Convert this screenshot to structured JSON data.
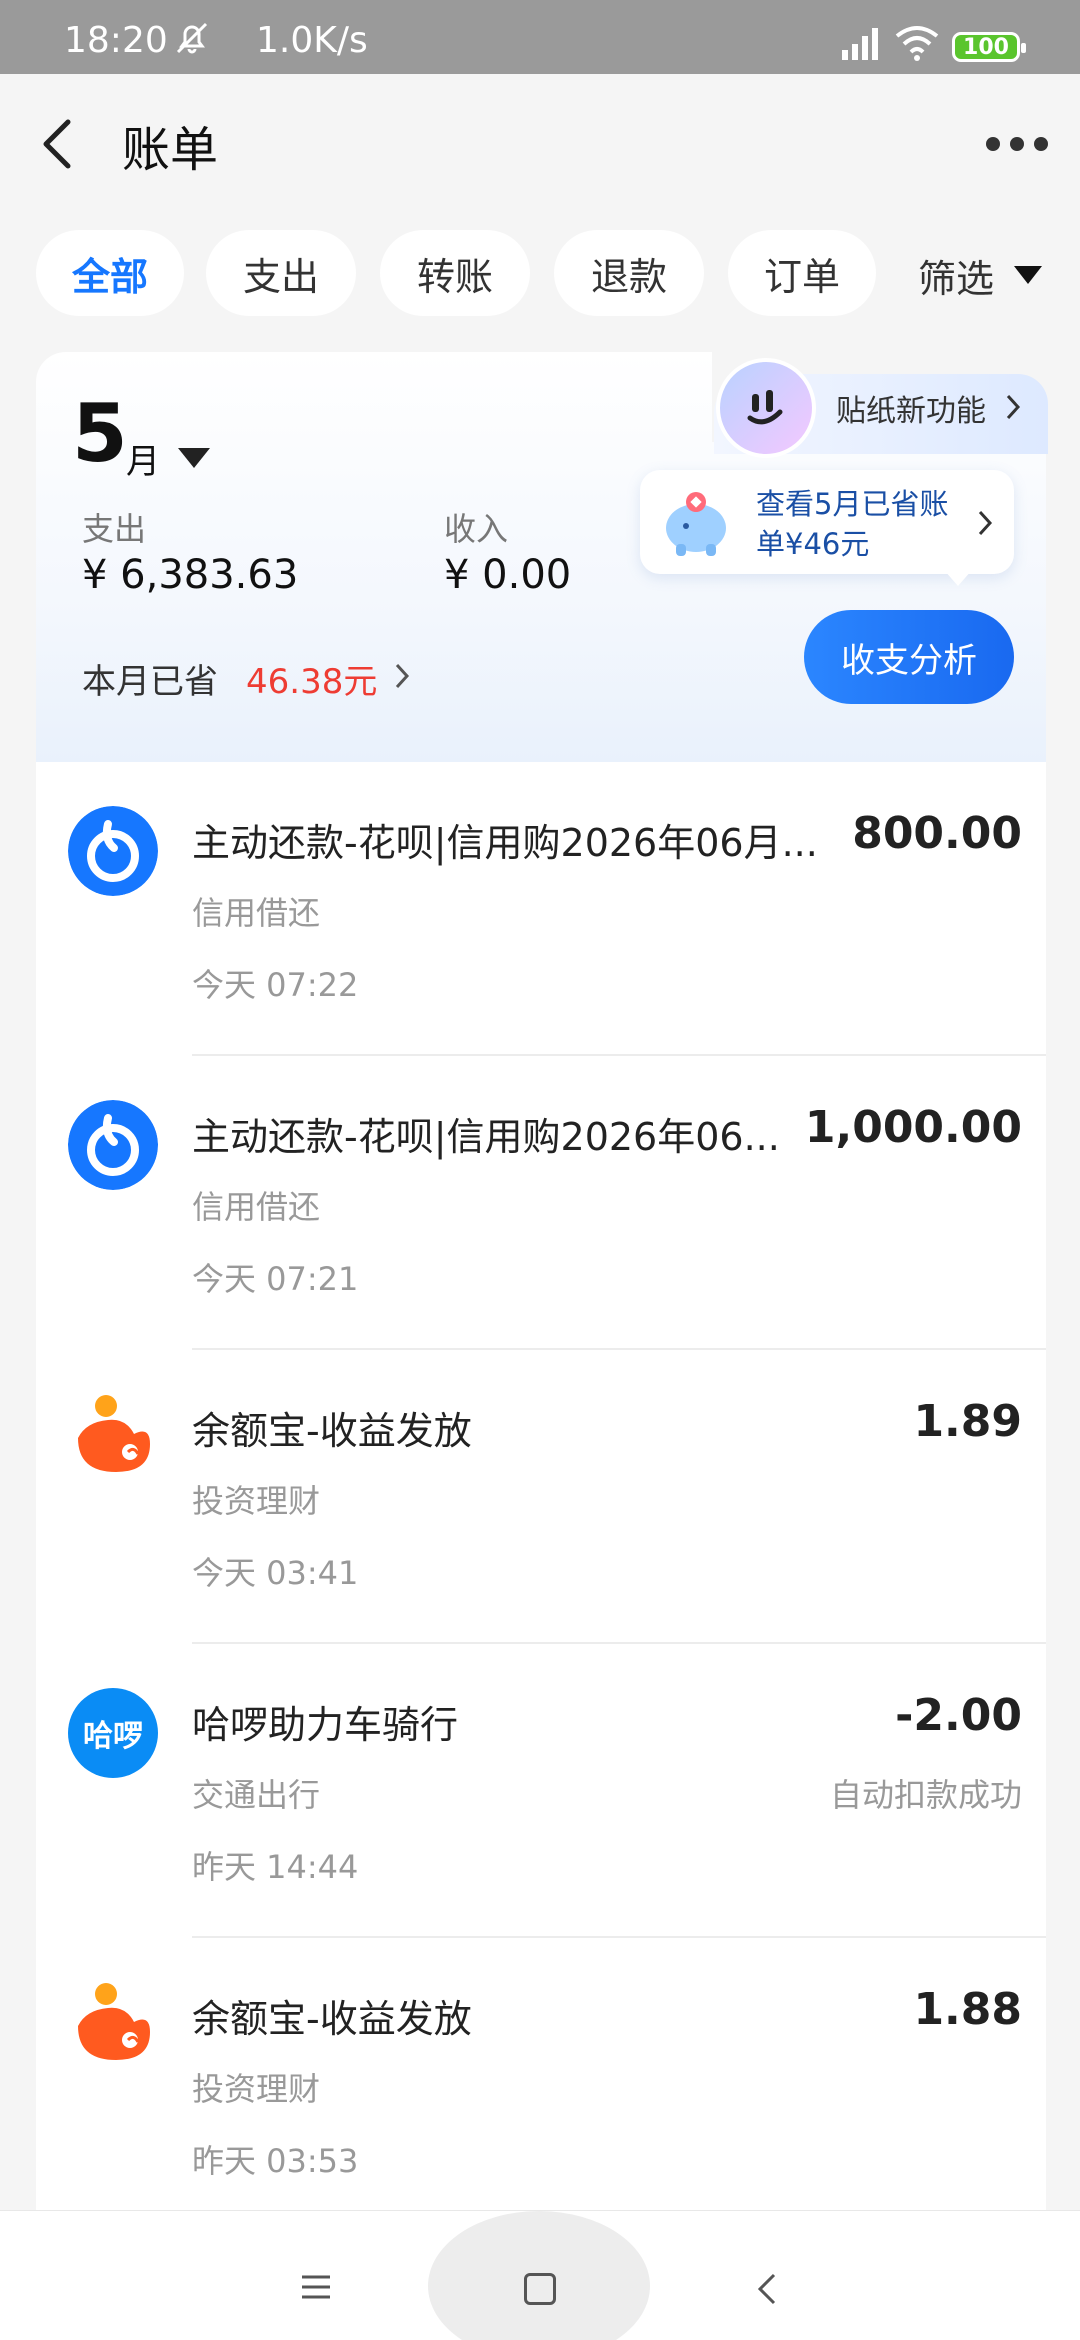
{
  "status_bar": {
    "time": "18:20",
    "net_speed": "1.0K/s",
    "battery": "100"
  },
  "header": {
    "title": "账单"
  },
  "tabs": [
    {
      "label": "全部",
      "active": true
    },
    {
      "label": "支出",
      "active": false
    },
    {
      "label": "转账",
      "active": false
    },
    {
      "label": "退款",
      "active": false
    },
    {
      "label": "订单",
      "active": false
    }
  ],
  "filter_label": "筛选",
  "summary": {
    "month": "5",
    "month_unit": "月",
    "expense_label": "支出",
    "expense_value": "¥ 6,383.63",
    "income_label": "收入",
    "income_value": "¥ 0.00",
    "saved_label": "本月已省",
    "saved_value": "46.38元",
    "sticker_label": "贴纸新功能",
    "bubble_text": "查看5月已省账单¥46元",
    "analysis_button": "收支分析"
  },
  "transactions": [
    {
      "title": "主动还款-花呗|信用购2026年06月...",
      "amount": "800.00",
      "category": "信用借还",
      "time": "今天 07:22",
      "status": "",
      "icon": "huabei-icon"
    },
    {
      "title": "主动还款-花呗|信用购2026年06...",
      "amount": "1,000.00",
      "category": "信用借还",
      "time": "今天 07:21",
      "status": "",
      "icon": "huabei-icon"
    },
    {
      "title": "余额宝-收益发放",
      "amount": "1.89",
      "category": "投资理财",
      "time": "今天 03:41",
      "status": "",
      "icon": "yuebao-icon"
    },
    {
      "title": "哈啰助力车骑行",
      "amount": "-2.00",
      "category": "交通出行",
      "time": "昨天 14:44",
      "status": "自动扣款成功",
      "icon": "hellobike-icon",
      "icon_text": "哈啰"
    },
    {
      "title": "余额宝-收益发放",
      "amount": "1.88",
      "category": "投资理财",
      "time": "昨天 03:53",
      "status": "",
      "icon": "yuebao-icon"
    }
  ],
  "colors": {
    "accent": "#1677ff",
    "saved_red": "#ee3c33",
    "huabei_blue": "#1677ff",
    "yuebao_orange": "#ff5a1f"
  }
}
